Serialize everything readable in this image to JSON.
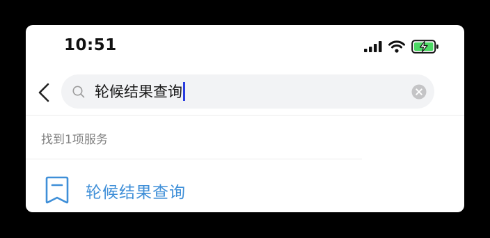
{
  "status_bar": {
    "time": "10:51",
    "icons": [
      "signal-icon",
      "wifi-icon",
      "battery-charging-icon"
    ]
  },
  "search": {
    "back_icon": "chevron-left-icon",
    "search_icon": "search-icon",
    "query": "轮候结果查询",
    "clear_icon": "clear-circle-icon"
  },
  "results": {
    "count_text": "找到1项服务",
    "items": [
      {
        "icon": "bookmark-document-icon",
        "title": "轮候结果查询"
      }
    ]
  },
  "colors": {
    "accent": "#3f8fd8",
    "caret": "#2a3de0",
    "battery_fill": "#4cd964"
  }
}
